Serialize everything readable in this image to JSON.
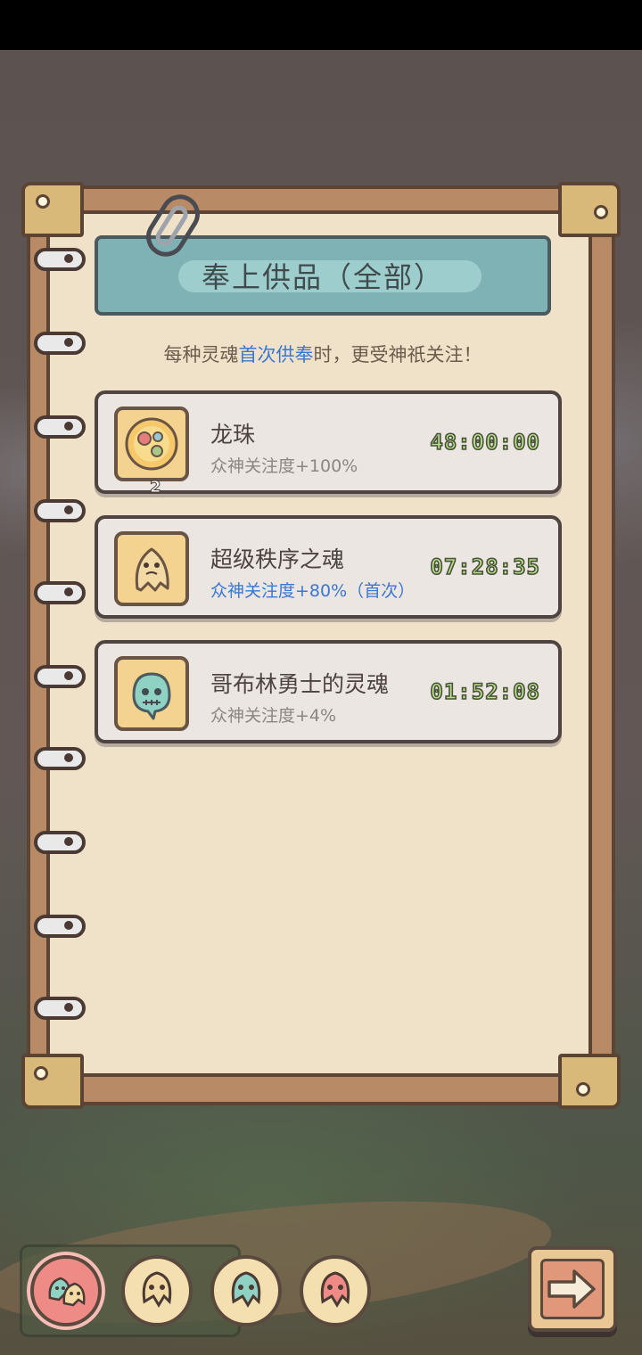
{
  "dialog": {
    "title": "奉上供品（全部）",
    "subtitle_before": "每种灵魂",
    "subtitle_highlight": "首次供奉",
    "subtitle_after": "时，更受神祇关注！"
  },
  "offerings": [
    {
      "name": "龙珠",
      "bonus": "众神关注度+100%",
      "timer": "48:00:00",
      "count": "2",
      "icon": "dragon-orb-icon",
      "bonus_highlighted": false
    },
    {
      "name": "超级秩序之魂",
      "bonus": "众神关注度+80%（首次）",
      "timer": "07:28:35",
      "icon": "order-soul-icon",
      "bonus_highlighted": true
    },
    {
      "name": "哥布林勇士的灵魂",
      "bonus": "众神关注度+4%",
      "timer": "01:52:08",
      "icon": "goblin-soul-icon",
      "bonus_highlighted": false
    }
  ],
  "bottom_tabs": [
    {
      "icon": "all-souls-icon",
      "active": true
    },
    {
      "icon": "yellow-soul-icon",
      "active": false
    },
    {
      "icon": "teal-soul-icon",
      "active": false
    },
    {
      "icon": "red-soul-icon",
      "active": false
    }
  ],
  "colors": {
    "highlight_blue": "#3a76d2",
    "timer_green": "#b9e08a",
    "banner_teal": "#7fb2b4",
    "page_paper": "#efe2c9"
  }
}
